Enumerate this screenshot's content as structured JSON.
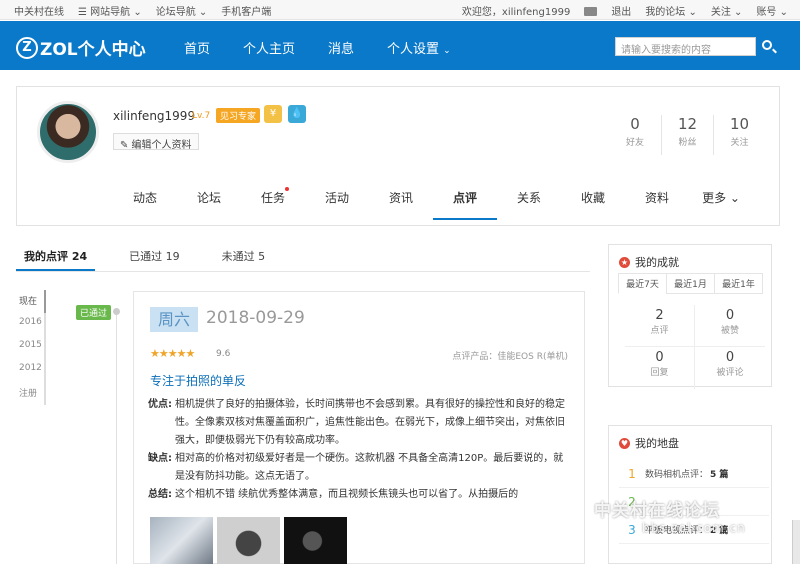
{
  "topbar": {
    "left": [
      "中关村在线",
      "☰ 网站导航 ⌄",
      "论坛导航 ⌄",
      "手机客户端"
    ],
    "welcome": "欢迎您，xilinfeng1999",
    "logout": "退出",
    "my_forum": "我的论坛 ⌄",
    "follow": "关注 ⌄",
    "account": "账号 ⌄"
  },
  "header": {
    "logo_mark": "Z",
    "logo_text": "ZOL个人中心",
    "nav": [
      "首页",
      "个人主页",
      "消息",
      "个人设置"
    ],
    "search_placeholder": "请输入要搜索的内容"
  },
  "profile": {
    "username": "xilinfeng1999",
    "level": "Lv.7",
    "badge_learn": "见习专家",
    "badge_y": "¥",
    "badge_b": "💧",
    "edit_label": "✎ 编辑个人资料",
    "stats": [
      {
        "num": "0",
        "label": "好友"
      },
      {
        "num": "12",
        "label": "粉丝"
      },
      {
        "num": "10",
        "label": "关注"
      }
    ],
    "tabs": [
      "动态",
      "论坛",
      "任务",
      "活动",
      "资讯",
      "点评",
      "关系",
      "收藏",
      "资料",
      "更多 ⌄"
    ]
  },
  "subtabs": [
    "我的点评 24",
    "已通过 19",
    "未通过 5"
  ],
  "timeline": [
    "现在",
    "2016",
    "2015",
    "2012",
    "注册"
  ],
  "review": {
    "status": "已通过",
    "weekday": "周六",
    "date": "2018-09-29",
    "stars": "★★★★★",
    "score": "9.6",
    "product": "点评产品：佳能EOS R(单机)",
    "title": "专注于拍照的单反",
    "pros_k": "优点:",
    "pros": "相机提供了良好的拍摄体验，长时间携带也不会感到累。具有很好的操控性和良好的稳定性。全像素双核对焦覆盖面积广，追焦性能出色。在弱光下，成像上细节突出，对焦依旧强大，即便极弱光下仍有较高成功率。",
    "cons_k": "缺点:",
    "cons": "相对高的价格对初级爱好者是一个硬伤。这款机器 不具备全高清120P。最后要说的，就是没有防抖功能。这点无语了。",
    "summary_k": "总结:",
    "summary": "这个相机不错 续航优秀整体满意，而且视频长焦镜头也可以省了。从拍摄后的"
  },
  "achievements": {
    "title": "我的成就",
    "icon": "★",
    "tabs": [
      "最近7天",
      "最近1月",
      "最近1年"
    ],
    "cells": [
      {
        "num": "2",
        "label": "点评"
      },
      {
        "num": "0",
        "label": "被赞"
      },
      {
        "num": "0",
        "label": "回复"
      },
      {
        "num": "0",
        "label": "被评论"
      }
    ]
  },
  "territory": {
    "title": "我的地盘",
    "icon": "♥",
    "rows": [
      {
        "rank": "1",
        "text": "数码相机点评：",
        "count": "5 篇"
      },
      {
        "rank": "2",
        "text": "",
        "count": ""
      },
      {
        "rank": "3",
        "text": "平板电视点评：",
        "count": "2 篇"
      }
    ]
  },
  "watermark": {
    "line1": "中关村在线论坛",
    "line2": "bbs.zol.com.cn"
  },
  "colors": {
    "brand": "#0b79c9",
    "pass": "#69b84b",
    "star": "#f0a52a"
  }
}
